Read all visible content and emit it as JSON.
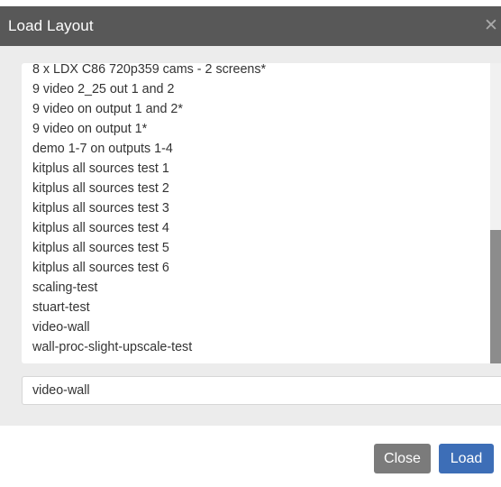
{
  "dialog": {
    "title": "Load Layout",
    "close_icon": "close-icon",
    "layouts": [
      "8 x LDX C86 720p359 cams - 2 screens*",
      "9 video 2_25 out 1 and 2",
      "9 video on output 1 and 2*",
      "9 video on output 1*",
      "demo 1-7 on outputs 1-4",
      "kitplus all sources test 1",
      "kitplus all sources test 2",
      "kitplus all sources test 3",
      "kitplus all sources test 4",
      "kitplus all sources test 5",
      "kitplus all sources test 6",
      "scaling-test",
      "stuart-test",
      "video-wall",
      "wall-proc-slight-upscale-test"
    ],
    "name_value": "video-wall",
    "buttons": {
      "close_label": "Close",
      "load_label": "Load"
    },
    "colors": {
      "titlebar": "#585858",
      "close_button": "#7b7b7b",
      "load_button": "#3d6eb7"
    }
  }
}
